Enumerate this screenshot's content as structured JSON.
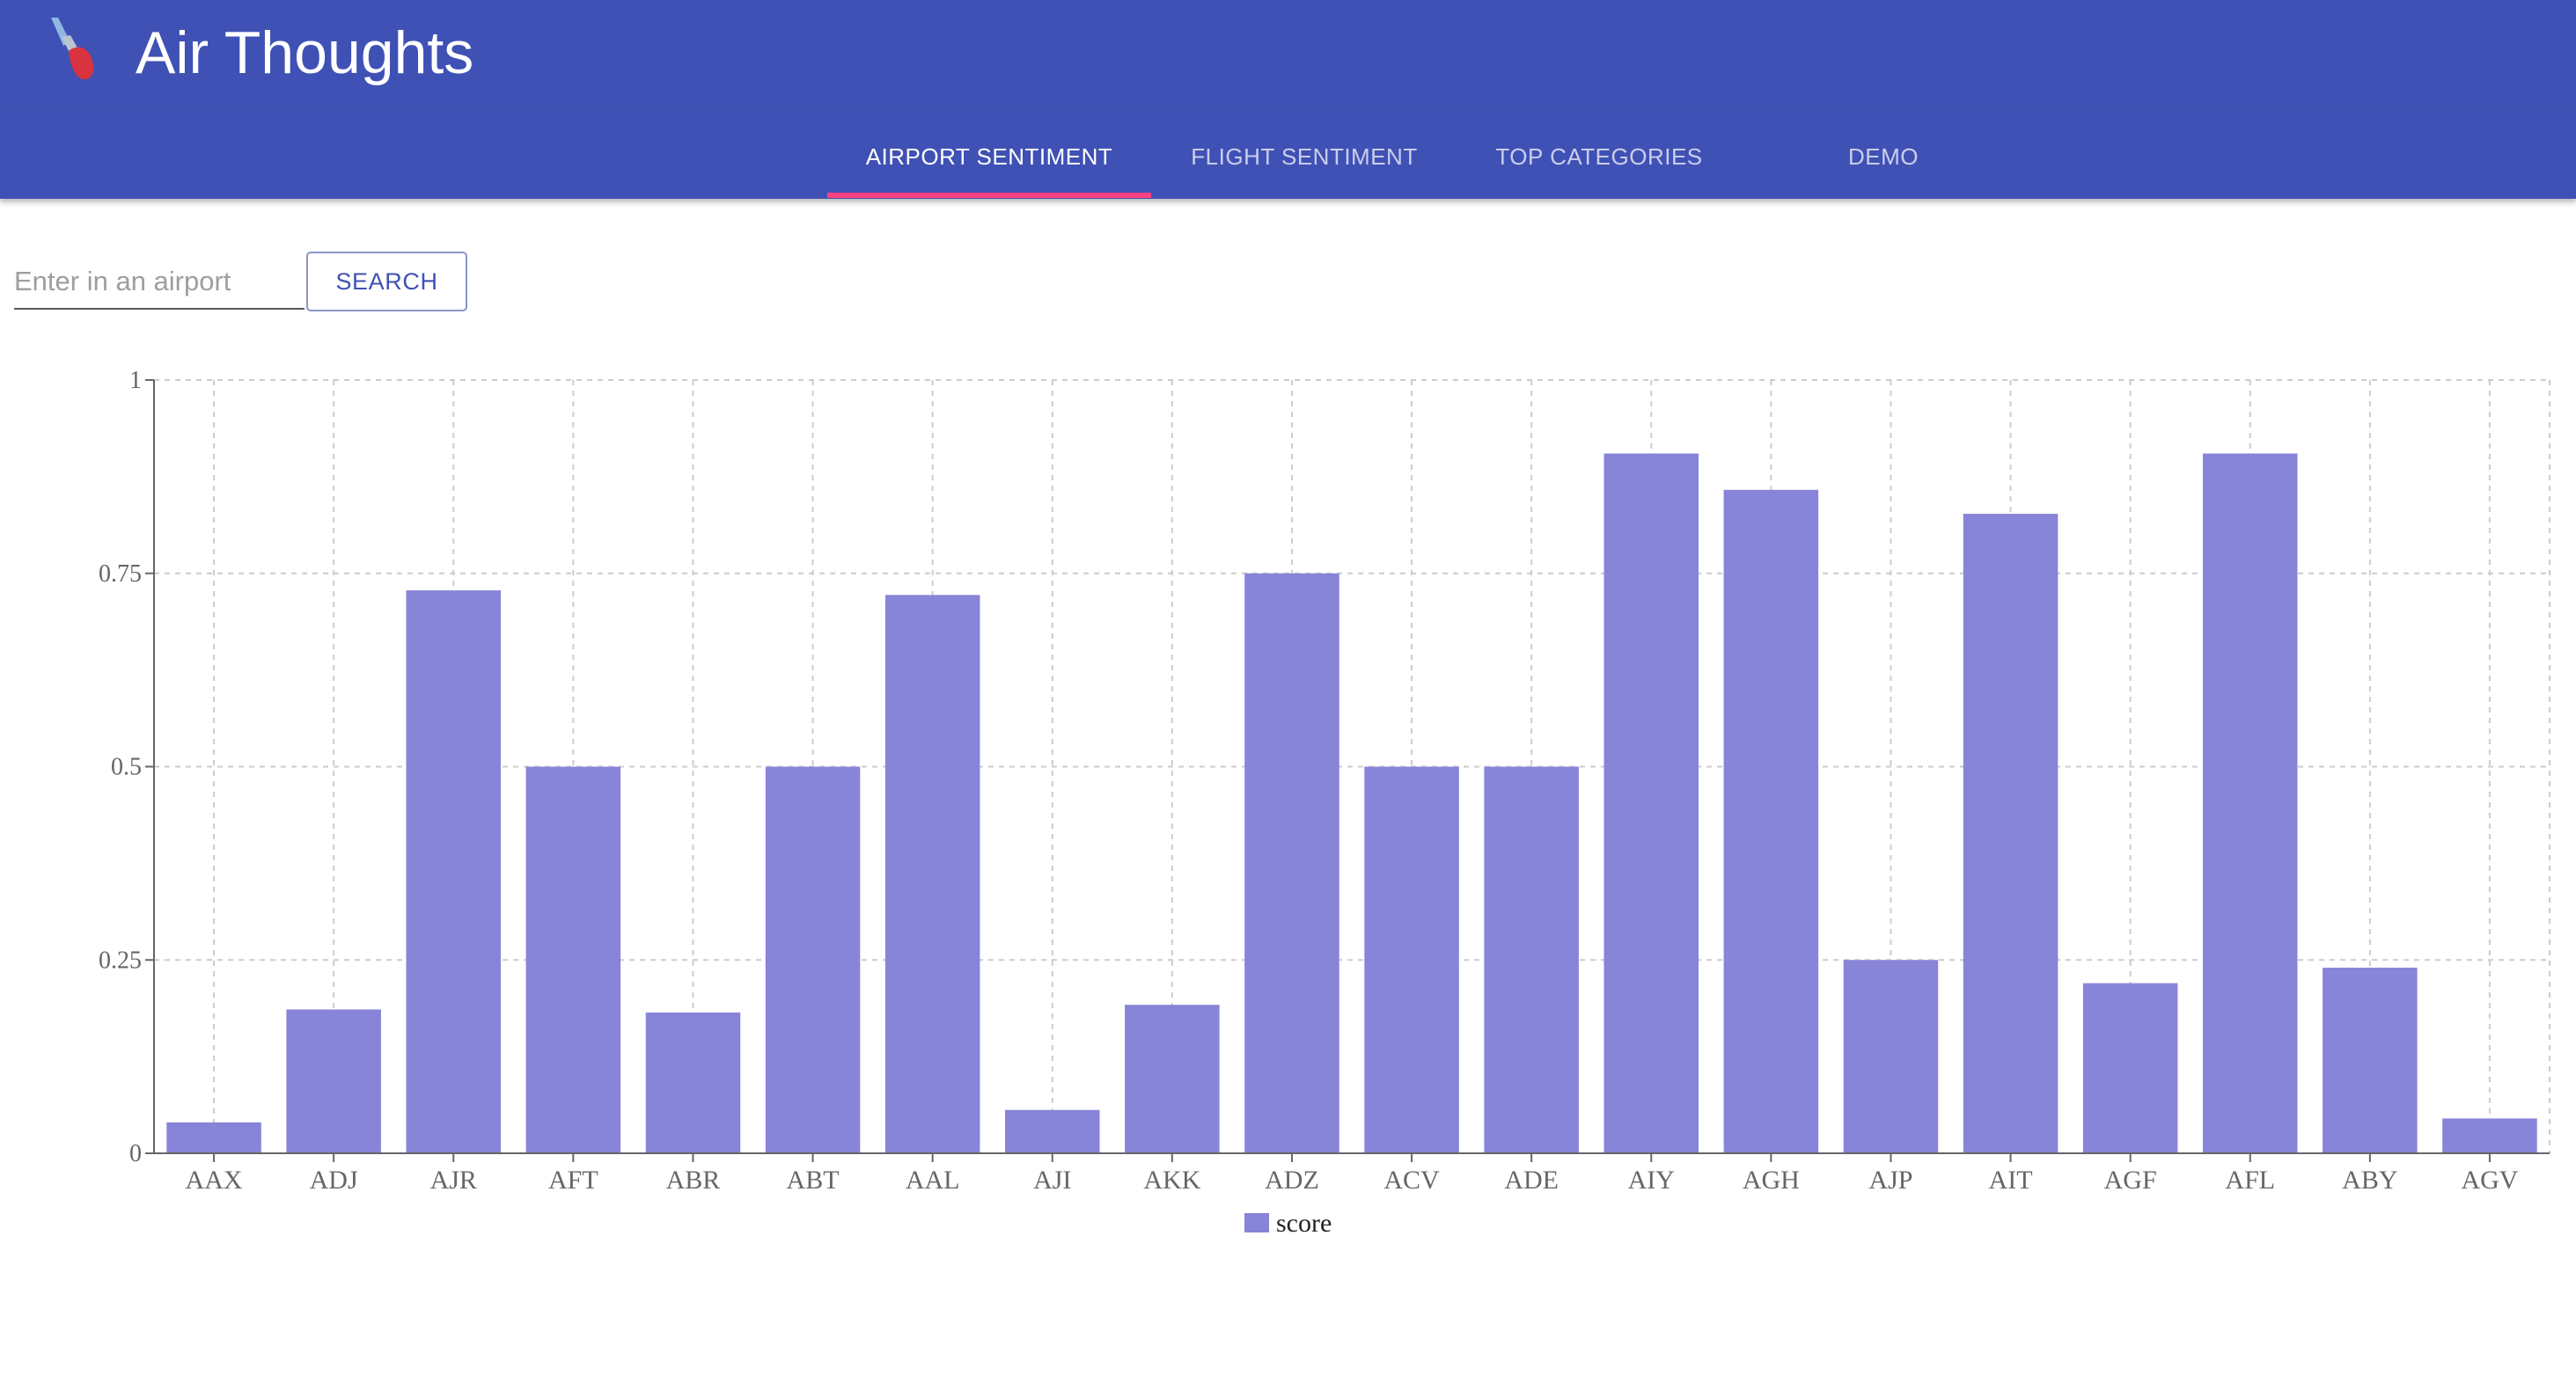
{
  "app": {
    "title": "Air Thoughts"
  },
  "tabs": [
    {
      "label": "AIRPORT SENTIMENT",
      "active": true
    },
    {
      "label": "FLIGHT SENTIMENT",
      "active": false
    },
    {
      "label": "TOP CATEGORIES",
      "active": false
    },
    {
      "label": "DEMO",
      "active": false
    }
  ],
  "search": {
    "placeholder": "Enter in an airport",
    "value": "",
    "button_label": "SEARCH"
  },
  "icons": {
    "logo": "airline-logo-icon"
  },
  "colors": {
    "appbar": "#3f51b5",
    "tab_indicator": "#ff4081",
    "bar": "#8884d8",
    "grid": "#cccccc",
    "axis": "#666666"
  },
  "chart_data": {
    "type": "bar",
    "categories": [
      "AAX",
      "ADJ",
      "AJR",
      "AFT",
      "ABR",
      "ABT",
      "AAL",
      "AJI",
      "AKK",
      "ADZ",
      "ACV",
      "ADE",
      "AIY",
      "AGH",
      "AJP",
      "AIT",
      "AGF",
      "AFL",
      "ABY",
      "AGV"
    ],
    "series": [
      {
        "name": "score",
        "values": [
          0.04,
          0.186,
          0.728,
          0.5,
          0.182,
          0.5,
          0.722,
          0.056,
          0.192,
          0.75,
          0.5,
          0.5,
          0.905,
          0.858,
          0.25,
          0.827,
          0.22,
          0.905,
          0.24,
          0.045
        ]
      }
    ],
    "yticks": [
      "0",
      "0.25",
      "0.5",
      "0.75",
      "1"
    ],
    "ylim": [
      0,
      1
    ],
    "grid": true,
    "legend": "bottom-center"
  }
}
